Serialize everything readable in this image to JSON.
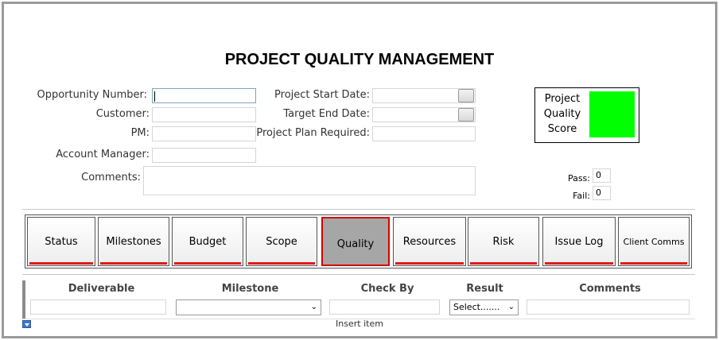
{
  "page": {
    "title": "PROJECT QUALITY MANAGEMENT"
  },
  "form": {
    "opportunity_number_label": "Opportunity Number:",
    "opportunity_number_value": "",
    "customer_label": "Customer:",
    "customer_value": "",
    "pm_label": "PM:",
    "pm_value": "",
    "account_manager_label": "Account Manager:",
    "account_manager_value": "",
    "comments_label": "Comments:",
    "comments_value": "",
    "project_start_date_label": "Project Start Date:",
    "project_start_date_value": "",
    "target_end_date_label": "Target End Date:",
    "target_end_date_value": "",
    "project_plan_required_label": "Project Plan Required:",
    "project_plan_required_value": ""
  },
  "score": {
    "label": "Project Quality Score",
    "color": "#00ff00",
    "pass_label": "Pass:",
    "pass_value": "0",
    "fail_label": "Fail:",
    "fail_value": "0"
  },
  "tabs": [
    {
      "label": "Status",
      "active": false
    },
    {
      "label": "Milestones",
      "active": false
    },
    {
      "label": "Budget",
      "active": false
    },
    {
      "label": "Scope",
      "active": false
    },
    {
      "label": "Quality",
      "active": true
    },
    {
      "label": "Resources",
      "active": false
    },
    {
      "label": "Risk",
      "active": false
    },
    {
      "label": "Issue Log",
      "active": false
    },
    {
      "label": "Client Comms",
      "active": false
    }
  ],
  "grid": {
    "columns": [
      "Deliverable",
      "Milestone",
      "Check By",
      "Result",
      "Comments"
    ],
    "new_row": {
      "deliverable": "",
      "milestone": "",
      "check_by": "",
      "result": "Select.......",
      "comments": ""
    },
    "insert_label": "Insert item"
  },
  "colors": {
    "accent_red": "#e21a1a",
    "active_tab_bg": "#a6a6a6",
    "score_green": "#00ff00"
  },
  "icons": {
    "calendar_button": "calendar-icon",
    "dropdown": "chevron-down-icon",
    "insert": "insert-arrow-icon"
  }
}
